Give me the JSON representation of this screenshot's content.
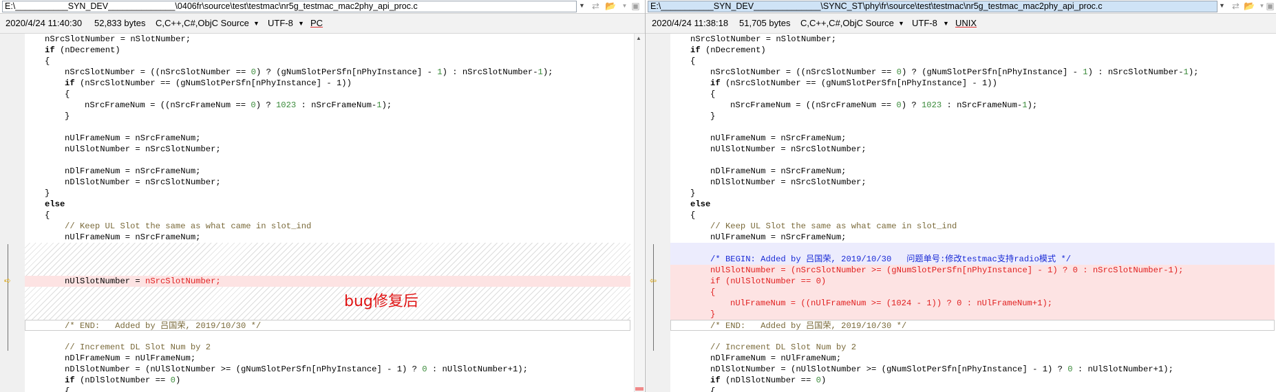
{
  "left": {
    "path": "E:\\___________SYN_DEV______________\\0406fr\\source\\test\\testmac\\nr5g_testmac_mac2phy_api_proc.c",
    "timestamp": "2020/4/24 11:40:30",
    "size": "52,833 bytes",
    "language": "C,C++,C#,ObjC Source",
    "encoding": "UTF-8",
    "line_ending": "PC",
    "annotation": "bug修复后"
  },
  "right": {
    "path": "E:\\___________SYN_DEV______________\\SYNC_ST\\phy\\fr\\source\\test\\testmac\\nr5g_testmac_mac2phy_api_proc.c",
    "timestamp": "2020/4/24 11:38:18",
    "size": "51,705 bytes",
    "language": "C,C++,C#,ObjC Source",
    "encoding": "UTF-8",
    "line_ending": "UNIX"
  },
  "dropdown_glyph": "▼",
  "colors": {
    "changed_bg": "#fde3e3",
    "inserted_bg": "#ececfd",
    "comment": "#7a6a3a",
    "number": "#3a8a3a",
    "diff_red": "#e02020",
    "diff_blue": "#1a2bd6",
    "arrow": "#d8a000"
  },
  "code": {
    "l01": "nSrcSlotNumber = nSlotNumber;",
    "l02_kw": "if",
    "l02_rest": " (nDecrement)",
    "brace_open": "{",
    "brace_close": "}",
    "l04_a": "nSrcSlotNumber = ((nSrcSlotNumber == ",
    "n0": "0",
    "l04_b": ") ? (gNumSlotPerSfn[nPhyInstance] - ",
    "n1": "1",
    "l04_c": ") : nSrcSlotNumber-",
    "l04_d": ");",
    "l05_kw": "if",
    "l05_rest": " (nSrcSlotNumber == (gNumSlotPerSfn[nPhyInstance] - 1))",
    "l07_a": "nSrcFrameNum = ((nSrcFrameNum == ",
    "l07_b": ") ? ",
    "n1023": "1023",
    "l07_c": " : nSrcFrameNum-",
    "l07_d": ");",
    "l10": "nUlFrameNum = nSrcFrameNum;",
    "l11": "nUlSlotNumber = nSrcSlotNumber;",
    "l13": "nDlFrameNum = nSrcFrameNum;",
    "l14": "nDlSlotNumber = nSrcSlotNumber;",
    "else_kw": "else",
    "l18_comment": "// Keep UL Slot the same as what came in slot_ind",
    "l19": "nUlFrameNum = nSrcFrameNum;",
    "left_changed_a": "nUlSlotNumber = ",
    "left_changed_b": "nSrcSlotNumber;",
    "r_begin": "/* BEGIN: Added by 吕国荣, 2019/10/30   问题单号:修改testmac支持radio模式 */",
    "r_changed1": "nUlSlotNumber = (nSrcSlotNumber >= (gNumSlotPerSfn[nPhyInstance] - 1) ? 0 : nSrcSlotNumber-1);",
    "r_changed2": "if (nUlSlotNumber == 0)",
    "r_changed4": "nUlFrameNum = ((nUlFrameNum >= (1024 - 1)) ? 0 : nUlFrameNum+1);",
    "end_comment": "/* END:   Added by 吕国荣, 2019/10/30 */",
    "inc_comment": "// Increment DL Slot Num by 2",
    "l_dlframe": "nDlFrameNum = nUlFrameNum;",
    "l_dlslot_a": "nDlSlotNumber = (nUlSlotNumber >= (gNumSlotPerSfn[nPhyInstance] - 1) ? ",
    "l_dlslot_b": " : nUlSlotNumber+1);",
    "l_if_kw": "if",
    "l_if_a": " (nDlSlotNumber == ",
    "l_if_b": ")"
  }
}
